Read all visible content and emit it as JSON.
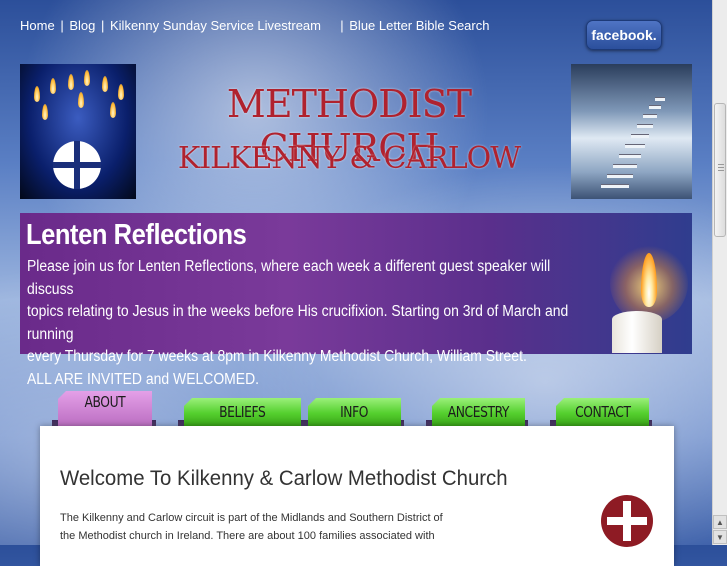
{
  "nav": {
    "items": [
      "Home",
      "Blog",
      "Kilkenny Sunday Service Livestream",
      "Blue Letter Bible Search"
    ],
    "separator": "|"
  },
  "facebook": {
    "label": "facebook."
  },
  "header": {
    "title_line1": "METHODIST CHURCH",
    "title_line2": "KILKENNY & CARLOW"
  },
  "banner": {
    "title": "Lenten Reflections",
    "text_line1": "Please join us for Lenten Reflections, where each week a different guest speaker will discuss",
    "text_line2": "topics relating to Jesus in the weeks before His crucifixion. Starting on 3rd of March and running",
    "text_line3": "every Thursday for 7 weeks at 8pm in Kilkenny Methodist Church, William Street.",
    "text_line4": "ALL ARE INVITED and WELCOMED."
  },
  "tabs": [
    {
      "label": "ABOUT",
      "active": true
    },
    {
      "label": "BELIEFS",
      "active": false
    },
    {
      "label": "INFO",
      "active": false
    },
    {
      "label": "ANCESTRY",
      "active": false
    },
    {
      "label": "CONTACT",
      "active": false
    }
  ],
  "content": {
    "heading": "Welcome To Kilkenny & Carlow Methodist Church",
    "intro_line1": "The Kilkenny and Carlow circuit is part of the Midlands and Southern District of",
    "intro_line2": "the Methodist church in Ireland. There are about 100 families associated with"
  },
  "colors": {
    "title_red": "#b0222e",
    "banner_purple": "#6a2a8a",
    "tab_green": "#54cf2e",
    "tab_active_pink": "#c57acb"
  }
}
